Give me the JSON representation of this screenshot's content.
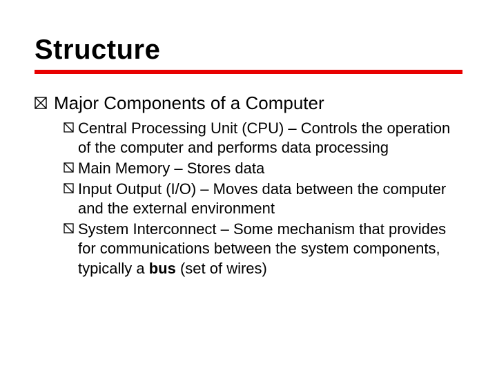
{
  "title": "Structure",
  "colors": {
    "rule": "#e80000",
    "bullet_outline": "#000000"
  },
  "lvl1": {
    "text": "Major Components of a Computer"
  },
  "lvl2": [
    {
      "text": "Central Processing Unit (CPU) – Controls the operation of the computer and performs data processing"
    },
    {
      "text": "Main Memory – Stores data"
    },
    {
      "text": "Input Output (I/O) – Moves data between the computer and the external environment"
    },
    {
      "prefix": "System Interconnect – Some mechanism that provides for communications between the system components, typically a ",
      "bold": "bus",
      "suffix": " (set of wires)"
    }
  ]
}
